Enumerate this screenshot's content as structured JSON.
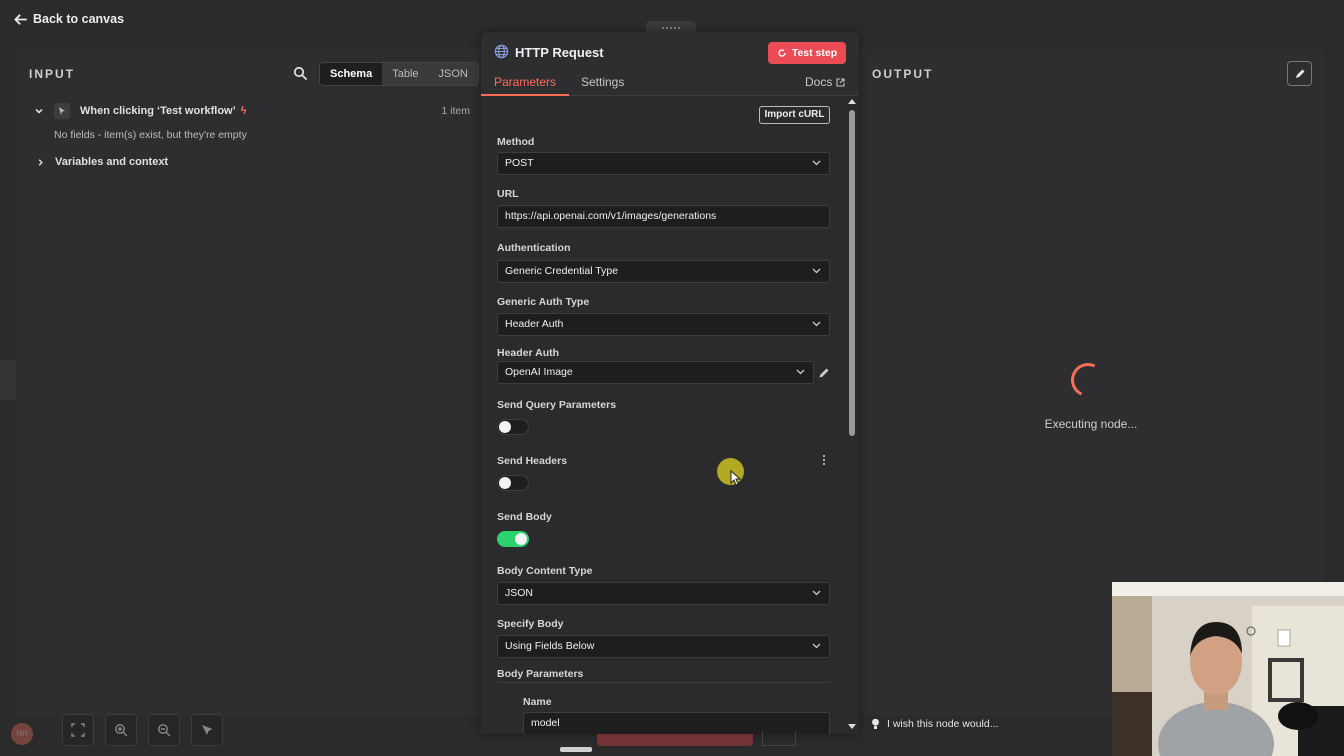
{
  "topbar": {
    "back_label": "Back to canvas"
  },
  "input": {
    "title": "INPUT",
    "view_tabs": [
      "Schema",
      "Table",
      "JSON"
    ],
    "active_view": "Schema",
    "trigger": {
      "label": "When clicking ‘Test workflow’",
      "count": "1 item"
    },
    "empty_note": "No fields - item(s) exist, but they're empty",
    "variables_label": "Variables and context"
  },
  "modal": {
    "title": "HTTP Request",
    "test_button": "Test step",
    "tabs": {
      "parameters": "Parameters",
      "settings": "Settings",
      "docs": "Docs"
    },
    "import_curl": "Import cURL",
    "fields": {
      "method": {
        "label": "Method",
        "value": "POST"
      },
      "url": {
        "label": "URL",
        "value": "https://api.openai.com/v1/images/generations"
      },
      "authentication": {
        "label": "Authentication",
        "value": "Generic Credential Type"
      },
      "generic_auth_type": {
        "label": "Generic Auth Type",
        "value": "Header Auth"
      },
      "header_auth": {
        "label": "Header Auth",
        "value": "OpenAI Image"
      },
      "send_query": {
        "label": "Send Query Parameters",
        "enabled": false
      },
      "send_headers": {
        "label": "Send Headers",
        "enabled": false
      },
      "send_body": {
        "label": "Send Body",
        "enabled": true
      },
      "body_content_type": {
        "label": "Body Content Type",
        "value": "JSON"
      },
      "specify_body": {
        "label": "Specify Body",
        "value": "Using Fields Below"
      },
      "body_parameters": {
        "label": "Body Parameters"
      },
      "param_name": {
        "label": "Name",
        "value": "model"
      }
    }
  },
  "output": {
    "title": "OUTPUT",
    "status": "Executing node..."
  },
  "bottom": {
    "wish_label": "I wish this node would..."
  },
  "colors": {
    "accent": "#ff6d5a",
    "test_button": "#ea4b54",
    "toggle_on": "#2cd26d"
  }
}
